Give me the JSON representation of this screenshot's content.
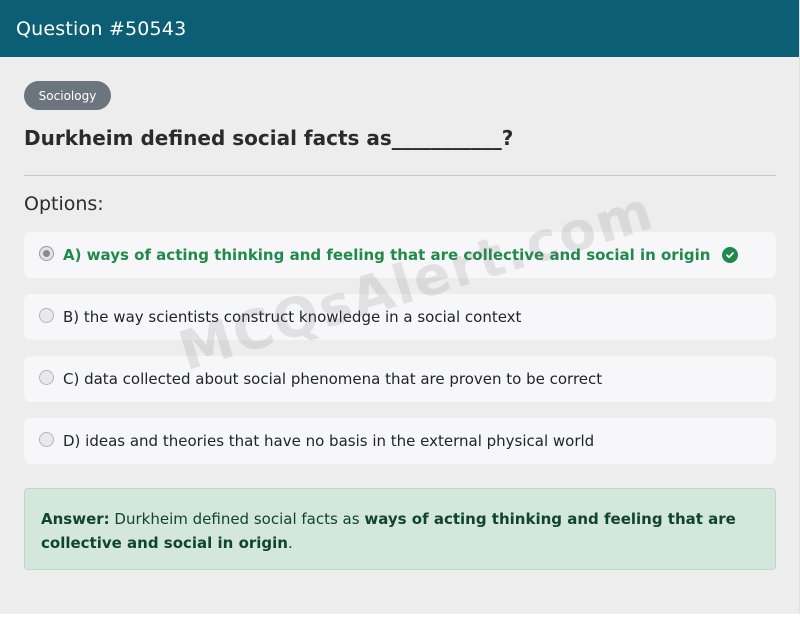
{
  "header": {
    "title": "Question #50543"
  },
  "question": {
    "category": "Sociology",
    "text": "Durkheim defined social facts as___________?"
  },
  "options_label": "Options:",
  "options": [
    {
      "text": "A) ways of acting thinking and feeling that are collective and social in origin",
      "correct": true
    },
    {
      "text": "B) the way scientists construct knowledge in a social context",
      "correct": false
    },
    {
      "text": "C) data collected about social phenomena that are proven to be correct",
      "correct": false
    },
    {
      "text": "D) ideas and theories that have no basis in the external physical world",
      "correct": false
    }
  ],
  "answer": {
    "label": "Answer:",
    "prefix": " Durkheim defined social facts as ",
    "value_line1": "ways of acting thinking and feeling that are",
    "value_line2": "collective and social in origin",
    "suffix": "."
  },
  "watermark": "MCQsAlert.com",
  "colors": {
    "header": "#0c5e74",
    "correct": "#1f8a4c",
    "answer_bg": "#d3e7dd"
  }
}
